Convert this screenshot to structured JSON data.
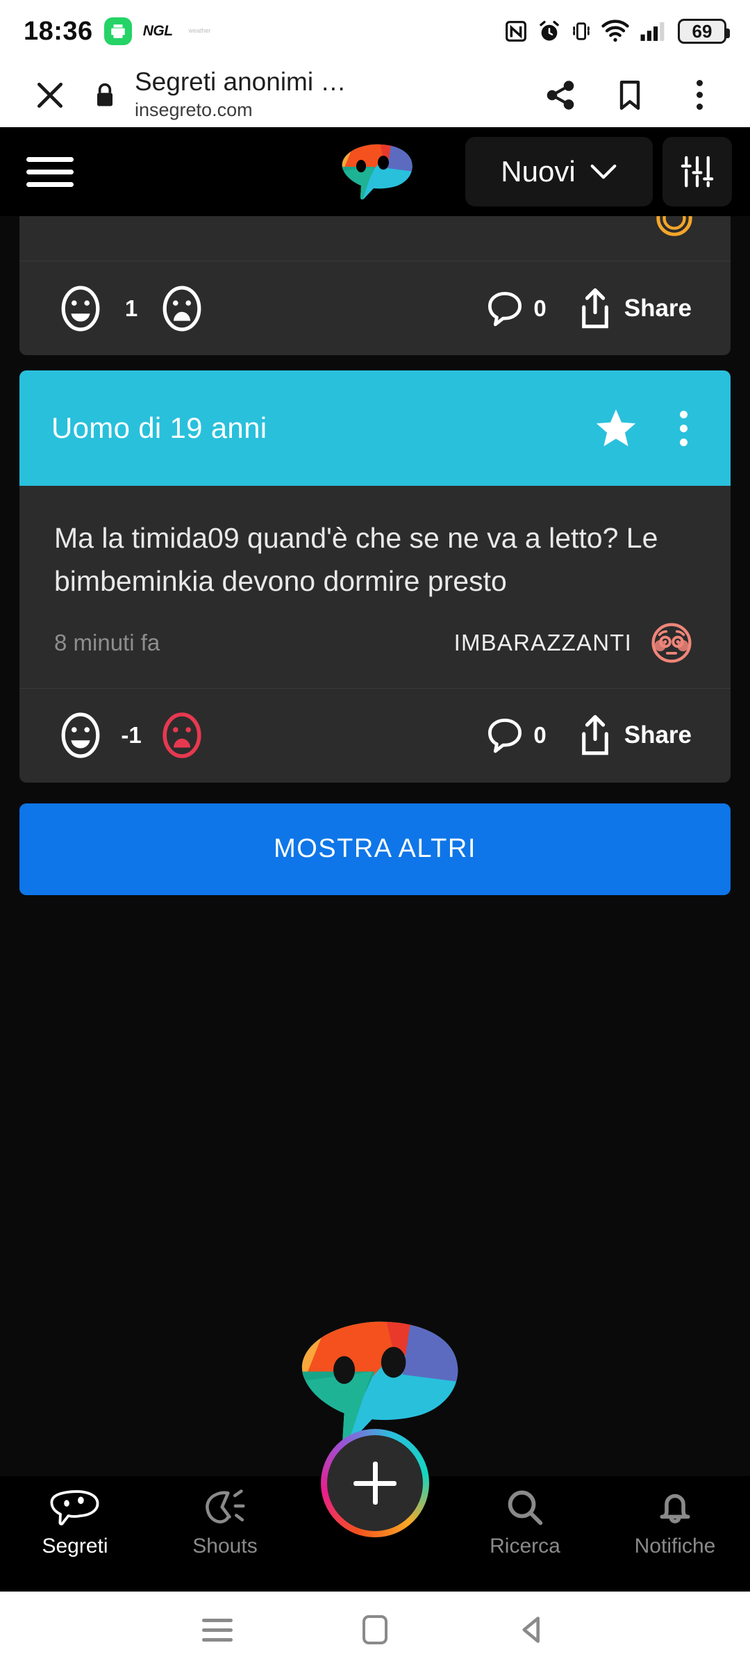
{
  "status_bar": {
    "time": "18:36",
    "battery_level": "69",
    "icons": [
      "whatsapp-app-icon",
      "ngl-icon",
      "weather-icon",
      "nfc-icon",
      "alarm-icon",
      "vibrate-icon",
      "wifi-icon",
      "signal-icon",
      "battery-icon"
    ]
  },
  "browser_bar": {
    "title": "Segreti anonimi …",
    "url": "insegreto.com",
    "close_label": "Chiudi",
    "actions": [
      "share-icon",
      "bookmark-icon",
      "overflow-menu-icon"
    ]
  },
  "app_header": {
    "menu_label": "Menu",
    "logo_name": "insegreto-parrot-logo",
    "sort_label": "Nuovi",
    "filter_label": "Filtri"
  },
  "feed": {
    "partial_post": {
      "reaction_emoji": "hugging-face-emoji",
      "upvote_count": "1",
      "comment_count": "0",
      "share_label": "Share",
      "upvote_state": "neutral",
      "downvote_state": "neutral"
    },
    "post": {
      "author": "Uomo di 19 anni",
      "starred": "true",
      "text": "Ma la timida09 quand'è che se ne va a letto? Le bimbeminkia devono dormire presto",
      "time_ago": "8 minuti fa",
      "category": "IMBARAZZANTI",
      "category_emoji": "flushed-face-emoji",
      "upvote_count": "-1",
      "comment_count": "0",
      "share_label": "Share",
      "upvote_state": "neutral",
      "downvote_state": "active"
    },
    "show_more_label": "MOSTRA ALTRI"
  },
  "bottom_nav": {
    "items": [
      {
        "label": "Segreti",
        "icon": "parrot-icon",
        "active": "true"
      },
      {
        "label": "Shouts",
        "icon": "megaphone-icon",
        "active": "false"
      },
      {
        "label": "Ricerca",
        "icon": "search-icon",
        "active": "false"
      },
      {
        "label": "Notifiche",
        "icon": "bell-icon",
        "active": "false"
      }
    ],
    "fab_label": "+"
  },
  "system_nav": {
    "recents_label": "Recenti",
    "home_label": "Home",
    "back_label": "Indietro"
  },
  "colors": {
    "accent_cyan": "#29C0DC",
    "accent_blue": "#0E76E8",
    "downvote_red": "#E63950",
    "card_bg": "#2c2c2c",
    "page_bg": "#0a0a0a"
  }
}
